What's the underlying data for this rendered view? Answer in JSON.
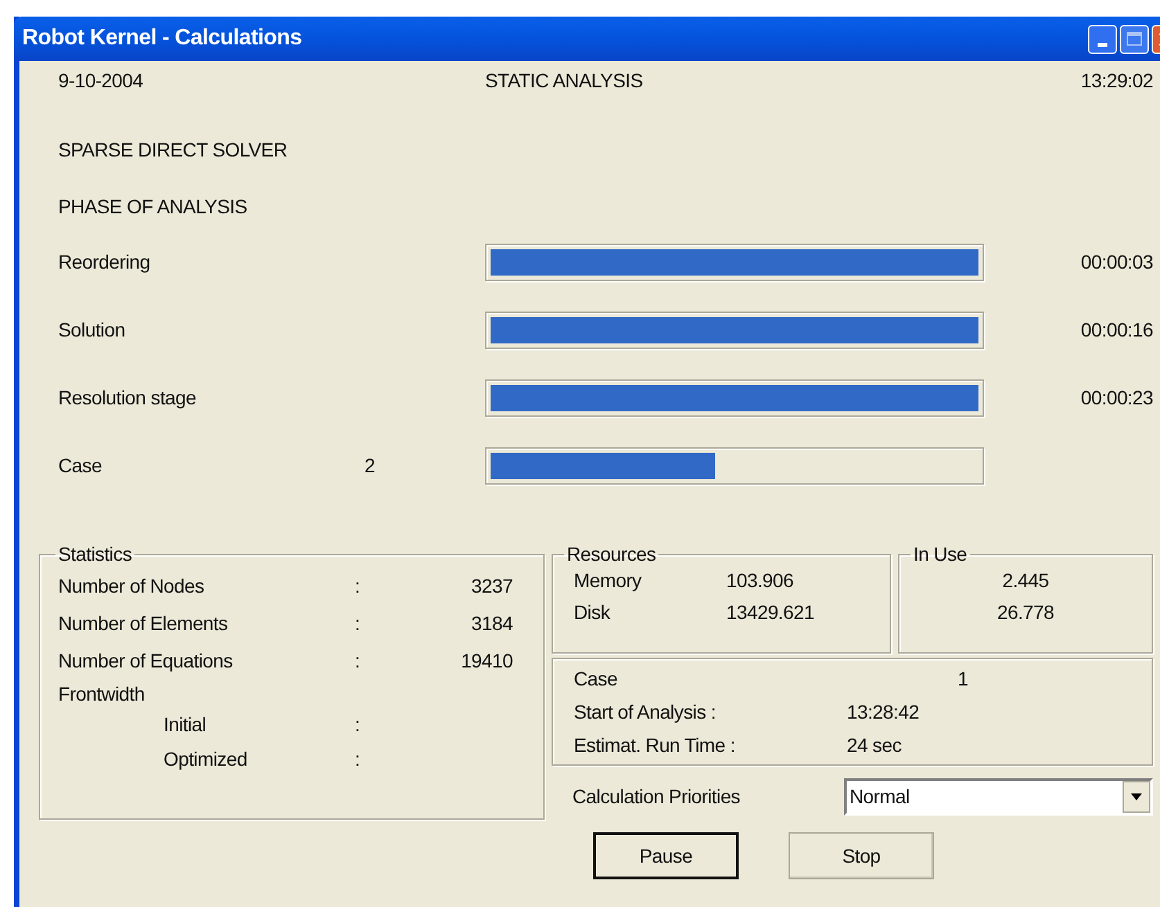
{
  "window": {
    "title": "Robot Kernel - Calculations"
  },
  "header": {
    "date": "9-10-2004",
    "analysis": "STATIC ANALYSIS",
    "time": "13:29:02"
  },
  "solver": "SPARSE DIRECT SOLVER",
  "phase_heading": "PHASE OF ANALYSIS",
  "stages": [
    {
      "label": "Reordering",
      "level": 1,
      "time": "00:00:03"
    },
    {
      "label": "Solution",
      "level": 1,
      "time": "00:00:16"
    },
    {
      "label": "Resolution stage",
      "level": 1,
      "time": "00:00:23"
    },
    {
      "label": "Case",
      "value": "2",
      "level": 0.46
    }
  ],
  "statistics": {
    "title": "Statistics",
    "rows": [
      {
        "label": "Number of Nodes",
        "sep": ":",
        "value": "3237"
      },
      {
        "label": "Number of Elements",
        "sep": ":",
        "value": "3184"
      },
      {
        "label": "Number of Equations",
        "sep": ":",
        "value": "19410"
      },
      {
        "label": "Frontwidth",
        "children": [
          {
            "label": "Initial",
            "sep": ":"
          },
          {
            "label": "Optimized",
            "sep": ":"
          }
        ]
      }
    ]
  },
  "resources": {
    "title": "Resources",
    "rows": [
      {
        "label": "Memory",
        "value": "103.906"
      },
      {
        "label": "Disk",
        "value": "13429.621"
      }
    ]
  },
  "in_use": {
    "title": "In Use",
    "values": [
      "2.445",
      "26.778"
    ]
  },
  "case_info": [
    {
      "label": "Case",
      "value": "1"
    },
    {
      "label": "Start of Analysis :",
      "value": "13:28:42"
    },
    {
      "label": "Estimat. Run Time :",
      "value": "24 sec"
    }
  ],
  "priorities": {
    "label": "Calculation Priorities",
    "value": "Normal"
  },
  "buttons": [
    {
      "label": "Pause",
      "default": true
    },
    {
      "label": "Stop",
      "default": false
    }
  ]
}
